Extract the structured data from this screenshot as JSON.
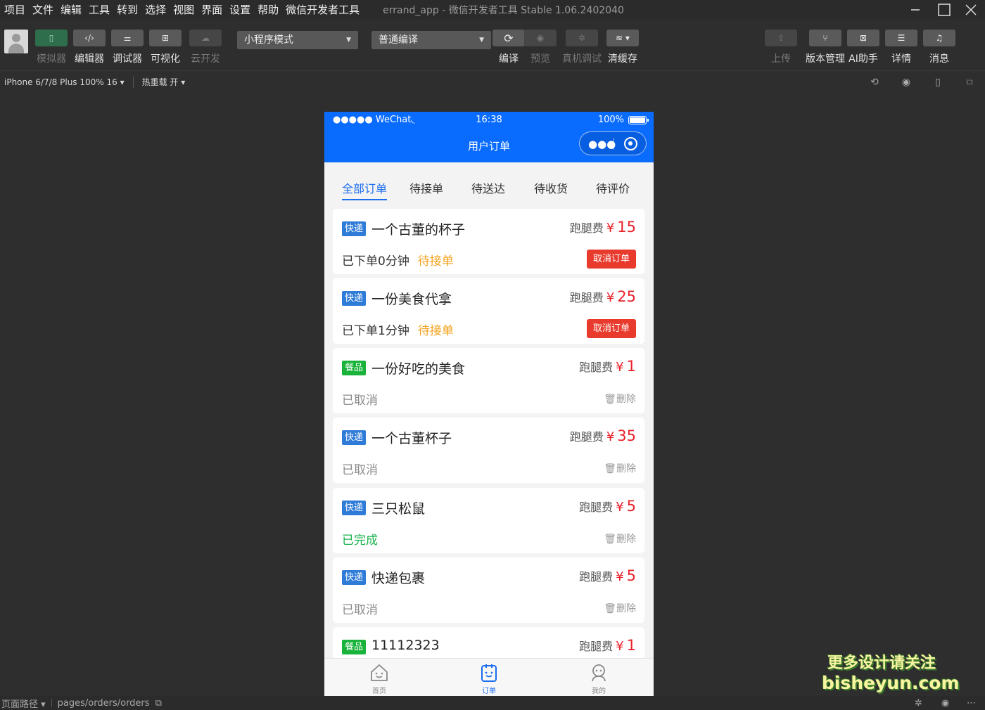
{
  "menubar": {
    "items": [
      "项目",
      "文件",
      "编辑",
      "工具",
      "转到",
      "选择",
      "视图",
      "界面",
      "设置",
      "帮助",
      "微信开发者工具"
    ],
    "title": "errand_app - 微信开发者工具 Stable 1.06.2402040"
  },
  "toolbar": {
    "left": [
      {
        "label": "模拟器",
        "icon": "phone-icon"
      },
      {
        "label": "编辑器",
        "icon": "code-icon"
      },
      {
        "label": "调试器",
        "icon": "debug-icon"
      },
      {
        "label": "可视化",
        "icon": "layout-icon"
      },
      {
        "label": "云开发",
        "icon": "cloud-icon"
      }
    ],
    "mode_select": "小程序模式",
    "compile_select": "普通编译",
    "center": [
      {
        "label": "编译",
        "icon": "refresh-icon"
      },
      {
        "label": "预览",
        "icon": "eye-icon"
      },
      {
        "label": "真机调试",
        "icon": "bug-icon"
      },
      {
        "label": "清缓存",
        "icon": "layers-icon"
      }
    ],
    "right": [
      {
        "label": "上传",
        "icon": "upload-icon"
      },
      {
        "label": "版本管理",
        "icon": "branch-icon"
      },
      {
        "label": "AI助手",
        "icon": "ai-icon"
      },
      {
        "label": "详情",
        "icon": "menu-icon"
      },
      {
        "label": "消息",
        "icon": "bell-icon"
      }
    ]
  },
  "devbar": {
    "device": "iPhone 6/7/8 Plus 100% 16 ▾",
    "hotreload": "热重载 开 ▾"
  },
  "phone": {
    "status": {
      "carrier": "●●●●● WeChat",
      "time": "16:38",
      "battery": "100%"
    },
    "nav_title": "用户订单",
    "tabs": [
      "全部订单",
      "待接单",
      "待送达",
      "待收货",
      "待评价"
    ],
    "fee_label": "跑腿费",
    "currency": "¥",
    "cancel_label": "取消订单",
    "delete_label": "删除",
    "orders": [
      {
        "badge": "快递",
        "type": "express",
        "title": "一个古董的杯子",
        "fee": "15",
        "status": "已下单0分钟",
        "pending": "待接单",
        "action": "cancel"
      },
      {
        "badge": "快递",
        "type": "express",
        "title": "一份美食代拿",
        "fee": "25",
        "status": "已下单1分钟",
        "pending": "待接单",
        "action": "cancel"
      },
      {
        "badge": "餐品",
        "type": "food",
        "title": "一份好吃的美食",
        "fee": "1",
        "status": "已取消",
        "pending": "",
        "action": "delete"
      },
      {
        "badge": "快递",
        "type": "express",
        "title": "一个古董杯子",
        "fee": "35",
        "status": "已取消",
        "pending": "",
        "action": "delete"
      },
      {
        "badge": "快递",
        "type": "express",
        "title": "三只松鼠",
        "fee": "5",
        "status": "已完成",
        "pending": "",
        "action": "delete"
      },
      {
        "badge": "快递",
        "type": "express",
        "title": "快递包裹",
        "fee": "5",
        "status": "已取消",
        "pending": "",
        "action": "delete"
      },
      {
        "badge": "餐品",
        "type": "food",
        "title": "11112323",
        "fee": "1",
        "status": "",
        "pending": "",
        "action": "none"
      }
    ],
    "tabbar": [
      {
        "label": "首页",
        "icon": "home-icon"
      },
      {
        "label": "订单",
        "icon": "order-icon"
      },
      {
        "label": "我的",
        "icon": "user-icon"
      }
    ]
  },
  "watermark": {
    "line1": "更多设计请关注",
    "line2": "bisheyun.com"
  },
  "bottombar": {
    "path_label": "页面路径 ▾",
    "path": "pages/orders/orders"
  }
}
